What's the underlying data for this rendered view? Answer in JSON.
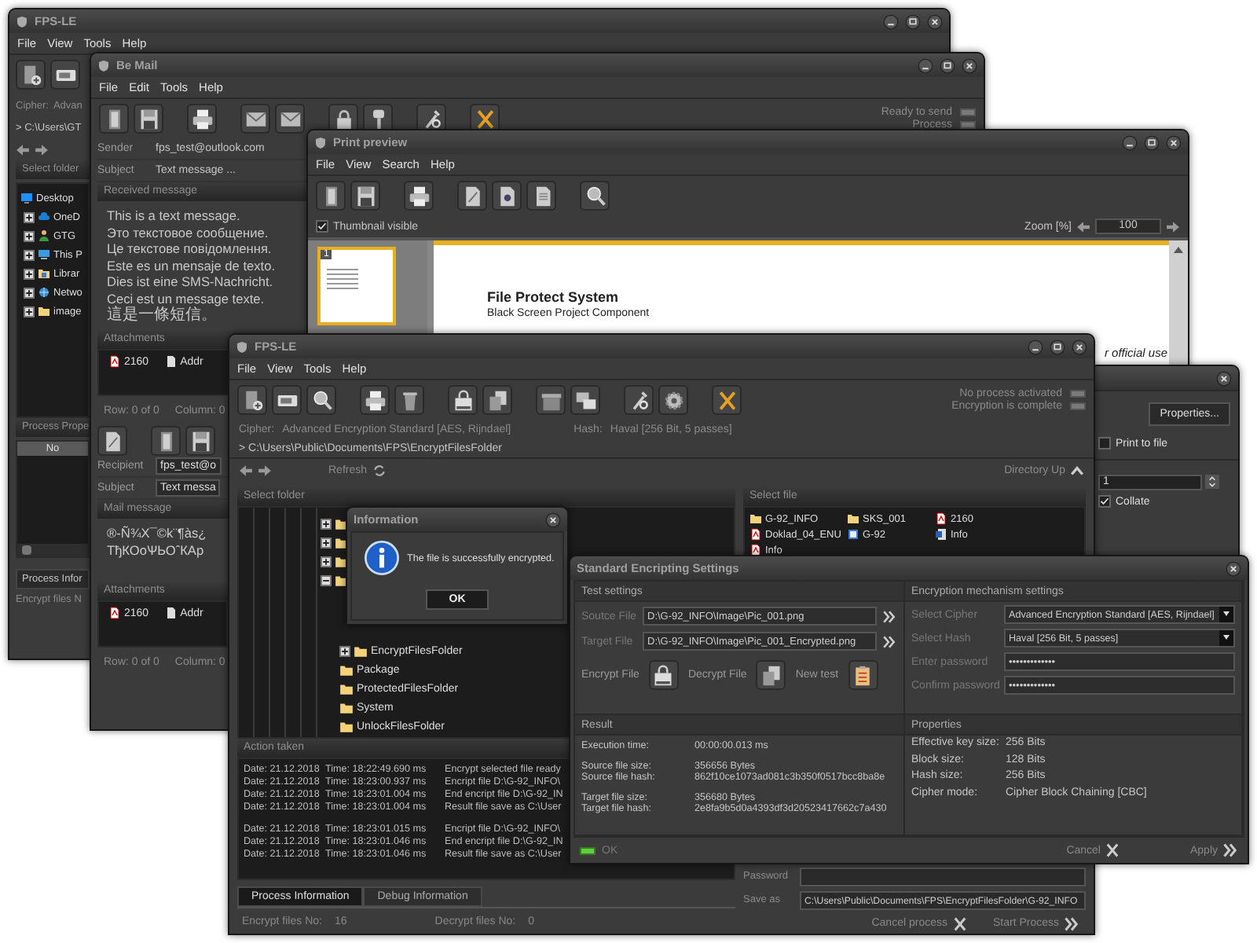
{
  "back_main_window": {
    "title": "FPS-LE",
    "menu": [
      "File",
      "View",
      "Tools",
      "Help"
    ],
    "cipher_label": "Cipher:",
    "cipher": "Advan",
    "path": "> C:\\Users\\GT",
    "folder_heading": "Select folder",
    "folder_tree": [
      {
        "label": "Desktop",
        "kind": "desktop",
        "children": [
          {
            "label": "OneD",
            "kind": "cloud",
            "expanded": false
          },
          {
            "label": "GTG",
            "kind": "user",
            "expanded": false
          },
          {
            "label": "This P",
            "kind": "computer",
            "expanded": false
          },
          {
            "label": "Librar",
            "kind": "library",
            "expanded": false
          },
          {
            "label": "Netwo",
            "kind": "network",
            "expanded": false
          },
          {
            "label": "image",
            "kind": "folder",
            "expanded": false
          }
        ]
      }
    ],
    "properties_heading": "Process Prope",
    "column_heading": "No",
    "tab": "Process Infor",
    "status": "Encrypt files N"
  },
  "mail_window": {
    "title": "Be Mail",
    "menu": [
      "File",
      "Edit",
      "Tools",
      "Help"
    ],
    "status_lights": [
      {
        "label": "Ready to send",
        "on": false
      },
      {
        "label": "Process",
        "on": false
      }
    ],
    "sender_label": "Sender",
    "sender": "fps_test@outlook.com",
    "subject_label": "Subject",
    "subject": "Text message ...",
    "received_heading": "Received message",
    "received_lines": [
      {
        "text": "This is a text message.",
        "kind": "text"
      },
      {
        "text": "Это текстовое сообщение.",
        "kind": "text"
      },
      {
        "text": "Це текстове повідомлення.",
        "kind": "text"
      },
      {
        "text": "Este es un mensaje de texto.",
        "kind": "text"
      },
      {
        "text": "Dies ist eine SMS-Nachricht.",
        "kind": "text"
      },
      {
        "text": "Ceci est un message texte.",
        "kind": "text"
      },
      {
        "text": "這是一條短信。",
        "kind": "cjk"
      }
    ],
    "attachments_heading": "Attachments",
    "attachments": [
      {
        "name": "2160",
        "kind": "pdf"
      },
      {
        "name": "Addr",
        "kind": "document"
      }
    ],
    "row_status": "Row: 0 of 0",
    "column_status": "Column: 0",
    "recipient_label": "Recipient",
    "recipient": "fps_test@o",
    "compose_subject_label": "Subject",
    "compose_subject": "Text messa",
    "mail_heading": "Mail message",
    "mail_lines": [
      "®-Ñ¾Х¯©k¨¶às¿",
      "ТђКОоѰЬОˆКАр"
    ],
    "compose_attachments_heading": "Attachments",
    "compose_attachments": [
      {
        "name": "2160",
        "kind": "pdf"
      },
      {
        "name": "Addr",
        "kind": "document"
      }
    ],
    "compose_row_status": "Row: 0 of 0",
    "compose_column_status": "Column: 0"
  },
  "preview_window": {
    "title": "Print preview",
    "menu": [
      "File",
      "View",
      "Search",
      "Help"
    ],
    "thumbnail_toggle": {
      "label": "Thumbnail visible",
      "checked": true
    },
    "zoom_label": "Zoom [%]",
    "zoom_value": "100",
    "thumbnail_number": "1",
    "page_title": "File Protect System",
    "page_subtitle": "Black Screen Project Component",
    "page_note": "r official use"
  },
  "print_dialog": {
    "properties_button": "Properties...",
    "print_to_file": {
      "label": "Print to file",
      "checked": false
    },
    "copies": "1",
    "collate": {
      "label": "Collate",
      "checked": true
    }
  },
  "main_window": {
    "title": "FPS-LE",
    "menu": [
      "File",
      "View",
      "Tools",
      "Help"
    ],
    "status_lights": [
      {
        "label": "No process activated",
        "on": false
      },
      {
        "label": "Encryption is complete",
        "on": false
      }
    ],
    "cipher_label": "Cipher:",
    "cipher": "Advanced Encryption Standard [AES, Rijndael]",
    "hash_label": "Hash:",
    "hash": "Haval [256 Bit, 5 passes]",
    "path": "> C:\\Users\\Public\\Documents\\FPS\\EncryptFilesFolder",
    "refresh": "Refresh",
    "directory_up": "Directory Up",
    "folder_heading": "Select folder",
    "folder_tree": [
      {
        "expanded": false
      },
      {
        "expanded": false
      },
      {
        "expanded": false
      },
      {
        "expanded": true,
        "children": [
          {
            "label": "EncryptFilesFolder",
            "expanded": false
          },
          {
            "label": "Package"
          },
          {
            "label": "ProtectedFilesFolder"
          },
          {
            "label": "System"
          },
          {
            "label": "UnlockFilesFolder"
          }
        ]
      }
    ],
    "file_heading": "Select file",
    "files": [
      {
        "name": "G-92_INFO",
        "kind": "folder"
      },
      {
        "name": "SKS_001",
        "kind": "folder"
      },
      {
        "name": "2160",
        "kind": "pdf"
      },
      {
        "name": "Doklad_04_ENU",
        "kind": "pdf"
      },
      {
        "name": "G-92",
        "kind": "image"
      },
      {
        "name": "Info",
        "kind": "document"
      },
      {
        "name": "Info",
        "kind": "pdf"
      }
    ],
    "action_heading": "Action taken",
    "log": [
      {
        "entries": [
          {
            "date": "Date: 21.12.2018",
            "time": "Time: 18:22:49.690 ms",
            "message": "Encrypt selected file ready"
          },
          {
            "date": "Date: 21.12.2018",
            "time": "Time: 18:23:00.937 ms",
            "message": "Encript file D:\\G-92_INFO\\"
          },
          {
            "date": "Date: 21.12.2018",
            "time": "Time: 18:23:01.004 ms",
            "message": "End encript file D:\\G-92_IN"
          },
          {
            "date": "Date: 21.12.2018",
            "time": "Time: 18:23:01.004 ms",
            "message": "Result file save as C:\\User"
          }
        ]
      },
      {
        "entries": [
          {
            "date": "Date: 21.12.2018",
            "time": "Time: 18:23:01.015 ms",
            "message": "Encript file D:\\G-92_INFO\\"
          },
          {
            "date": "Date: 21.12.2018",
            "time": "Time: 18:23:01.046 ms",
            "message": "End encript file D:\\G-92_IN"
          },
          {
            "date": "Date: 21.12.2018",
            "time": "Time: 18:23:01.046 ms",
            "message": "Result file save as C:\\User"
          }
        ]
      }
    ],
    "tabs": [
      {
        "label": "Process Information",
        "selected": true
      },
      {
        "label": "Debug Information",
        "selected": false
      }
    ],
    "encrypt_label": "Encrypt files No:",
    "encrypt_count": "16",
    "decrypt_label": "Decrypt files No:",
    "decrypt_count": "0",
    "password_label": "Password",
    "save_as_label": "Save as",
    "save_as": "C:\\Users\\Public\\Documents\\FPS\\EncryptFilesFolder\\G-92_INFO",
    "cancel_button": "Cancel process",
    "start_button": "Start Process"
  },
  "info_dialog": {
    "title": "Information",
    "message": "The file is successfully encrypted.",
    "ok_button": "OK"
  },
  "settings_dialog": {
    "title": "Standard Encripting Settings",
    "test_heading": "Test settings",
    "source_label": "Soutce File",
    "source": "D:\\G-92_INFO\\Image\\Pic_001.png",
    "target_label": "Target File",
    "target": "D:\\G-92_INFO\\Image\\Pic_001_Encrypted.png",
    "actions": [
      {
        "label": "Encrypt File",
        "kind": "encrypt"
      },
      {
        "label": "Decrypt File",
        "kind": "decrypt"
      },
      {
        "label": "New test",
        "kind": "new"
      }
    ],
    "result_heading": "Result",
    "result_groups": [
      [
        {
          "label": "Execution time:",
          "value": "00:00:00.013 ms"
        }
      ],
      [
        {
          "label": "Source file size:",
          "value": "356656 Bytes"
        },
        {
          "label": "Source file hash:",
          "value": "862f10ce1073ad081c3b350f0517bcc8ba8e"
        }
      ],
      [
        {
          "label": "Target file size:",
          "value": "356680 Bytes"
        },
        {
          "label": "Target file hash:",
          "value": "2e8fa9b5d0a4393df3d20523417662c7a430"
        }
      ]
    ],
    "mechanism_heading": "Encryption mechanism settings",
    "cipher_label": "Select Cipher",
    "cipher": "Advanced Encryption Standard [AES, Rijndael]",
    "hash_label": "Select Hash",
    "hash": "Haval [256 Bit, 5 passes]",
    "password_label": "Enter password",
    "password": "•••••••••••••",
    "confirm_label": "Confirm password",
    "confirm": "•••••••••••••",
    "properties_heading": "Properties",
    "properties": [
      {
        "label": "Effective key size:",
        "value": "256 Bits"
      },
      {
        "label": "Block size:",
        "value": "128 Bits"
      },
      {
        "label": "Hash size:",
        "value": "256 Bits"
      },
      {
        "label": "Cipher mode:",
        "value": "Cipher Block Chaining [CBC]"
      }
    ],
    "ok_light": {
      "label": "OK",
      "on": true
    },
    "cancel_button": "Cancel",
    "apply_button": "Apply"
  }
}
